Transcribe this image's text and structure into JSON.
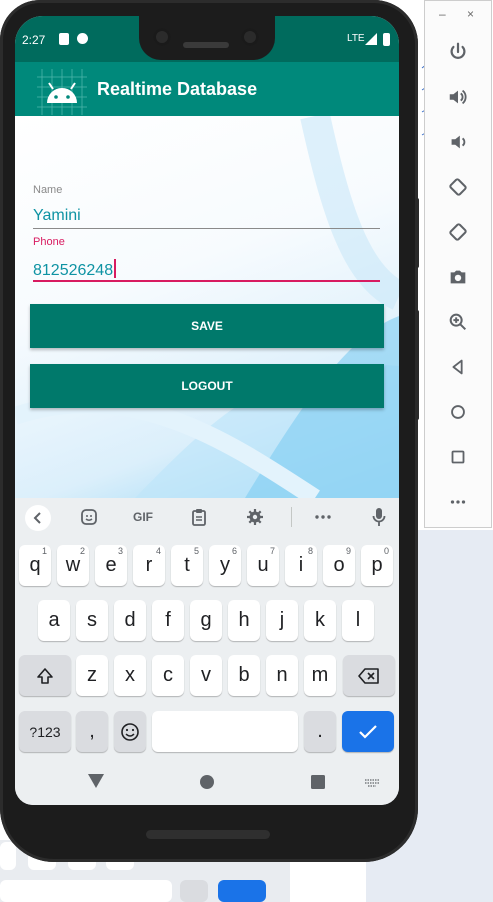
{
  "status_bar": {
    "time": "2:27",
    "network": "LTE"
  },
  "app_bar": {
    "title": "Realtime Database"
  },
  "form": {
    "name_label": "Name",
    "name_value": "Yamini",
    "phone_label": "Phone",
    "phone_value": "812526248"
  },
  "buttons": {
    "save_label": "SAVE",
    "logout_label": "LOGOUT"
  },
  "keyboard": {
    "gif_label": "GIF",
    "row1": [
      {
        "key": "q",
        "hint": "1"
      },
      {
        "key": "w",
        "hint": "2"
      },
      {
        "key": "e",
        "hint": "3"
      },
      {
        "key": "r",
        "hint": "4"
      },
      {
        "key": "t",
        "hint": "5"
      },
      {
        "key": "y",
        "hint": "6"
      },
      {
        "key": "u",
        "hint": "7"
      },
      {
        "key": "i",
        "hint": "8"
      },
      {
        "key": "o",
        "hint": "9"
      },
      {
        "key": "p",
        "hint": "0"
      }
    ],
    "row2": [
      "a",
      "s",
      "d",
      "f",
      "g",
      "h",
      "j",
      "k",
      "l"
    ],
    "row3": [
      "z",
      "x",
      "c",
      "v",
      "b",
      "n",
      "m"
    ],
    "symbols_label": "?123",
    "comma_label": ",",
    "period_label": "."
  },
  "colors": {
    "status_bar": "#006b5d",
    "app_bar": "#00897b",
    "button": "#00796b",
    "focus_accent": "#d81b60",
    "input_text": "#0e93a3",
    "keyboard_enter": "#1a73e8"
  },
  "icons": {
    "emulator_toolbar": [
      "minimize-icon",
      "close-icon",
      "power-icon",
      "volume-up-icon",
      "volume-down-icon",
      "rotate-left-icon",
      "rotate-right-icon",
      "camera-icon",
      "zoom-icon",
      "back-icon",
      "home-icon",
      "overview-icon",
      "more-icon"
    ]
  }
}
